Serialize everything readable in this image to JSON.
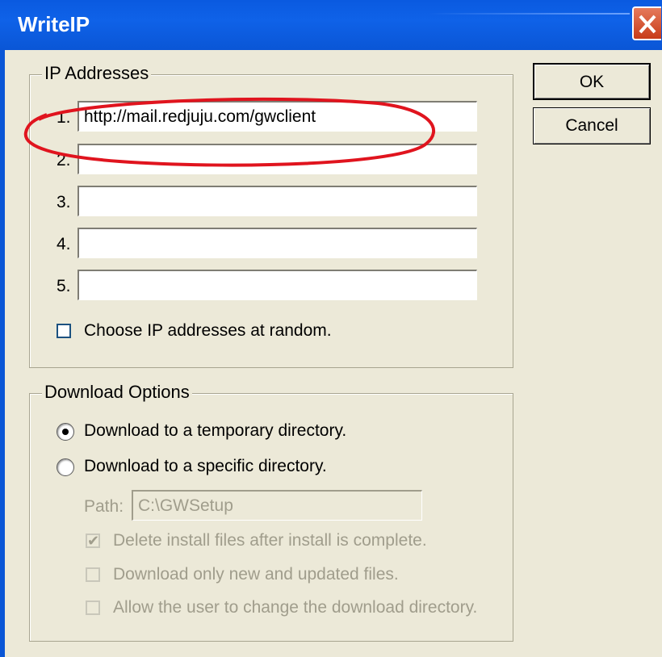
{
  "window": {
    "title": "WriteIP"
  },
  "ip_group": {
    "legend": "IP Addresses",
    "rows": [
      {
        "number": "1.",
        "value": "http://mail.redjuju.com/gwclient"
      },
      {
        "number": "2.",
        "value": ""
      },
      {
        "number": "3.",
        "value": ""
      },
      {
        "number": "4.",
        "value": ""
      },
      {
        "number": "5.",
        "value": ""
      }
    ],
    "random_checkbox_label": "Choose IP addresses at random.",
    "random_checked": false
  },
  "download_group": {
    "legend": "Download Options",
    "radio_temp_label": "Download to a temporary directory.",
    "radio_specific_label": "Download to a specific directory.",
    "selected": "temporary",
    "path_label": "Path:",
    "path_value": "C:\\GWSetup",
    "delete_label": "Delete install files after install is complete.",
    "delete_checked": true,
    "new_only_label": "Download only new and updated files.",
    "new_only_checked": false,
    "allow_change_label": "Allow the user to change the download directory.",
    "allow_change_checked": false
  },
  "buttons": {
    "ok": "OK",
    "cancel": "Cancel"
  },
  "colors": {
    "titlebar": "#0a5ae0",
    "dialog_bg": "#ece9d8",
    "highlight_ellipse": "#e0141e"
  }
}
